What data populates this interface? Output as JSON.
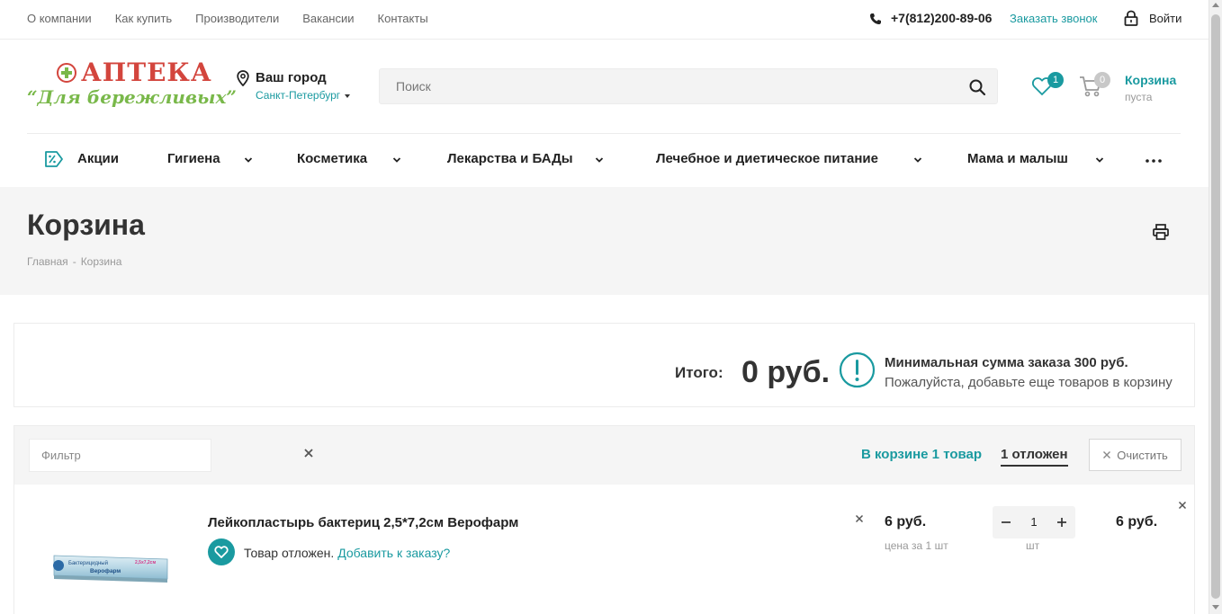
{
  "topnav": {
    "items": [
      "О компании",
      "Как купить",
      "Производители",
      "Вакансии",
      "Контакты"
    ],
    "phone": "+7(812)200-89-06",
    "callback": "Заказать звонок",
    "login": "Войти"
  },
  "logo": {
    "title": "АПТЕКА",
    "subtitle": "“Для бережливых”"
  },
  "city": {
    "label": "Ваш город",
    "value": "Санкт-Петербург"
  },
  "search": {
    "placeholder": "Поиск"
  },
  "header": {
    "favorites_count": "1",
    "cart_count": "0",
    "cart_title": "Корзина",
    "cart_status": "пуста"
  },
  "menu": {
    "items": [
      "Акции",
      "Гигиена",
      "Косметика",
      "Лекарства и БАДы",
      "Лечебное и диетическое питание",
      "Мама и малыш"
    ]
  },
  "page": {
    "title": "Корзина",
    "breadcrumb": [
      "Главная",
      "-",
      "Корзина"
    ]
  },
  "total": {
    "label": "Итого:",
    "value": "0 руб.",
    "min_title": "Минимальная сумма заказа 300 руб.",
    "min_sub": "Пожалуйста, добавьте еще товаров в корзину"
  },
  "basket": {
    "filter_placeholder": "Фильтр",
    "tab_incart": "В корзине 1 товар",
    "tab_delayed": "1 отложен",
    "clear_label": "Очистить",
    "items": [
      {
        "name": "Лейкопластырь бактериц 2,5*7,2см Верофарм",
        "delayed_text": "Товар отложен.",
        "delayed_link": "Добавить к заказу?",
        "price": "6 руб.",
        "price_sub": "цена за 1 шт",
        "qty": "1",
        "unit": "шт",
        "sum": "6 руб.",
        "image_text_1": "Бактерицидный",
        "image_text_2": "Верофарм",
        "image_size": "2,5х7,2см"
      }
    ]
  },
  "colors": {
    "accent": "#1a9aa0",
    "logo_red": "#d3453d",
    "logo_green": "#79b84a"
  }
}
